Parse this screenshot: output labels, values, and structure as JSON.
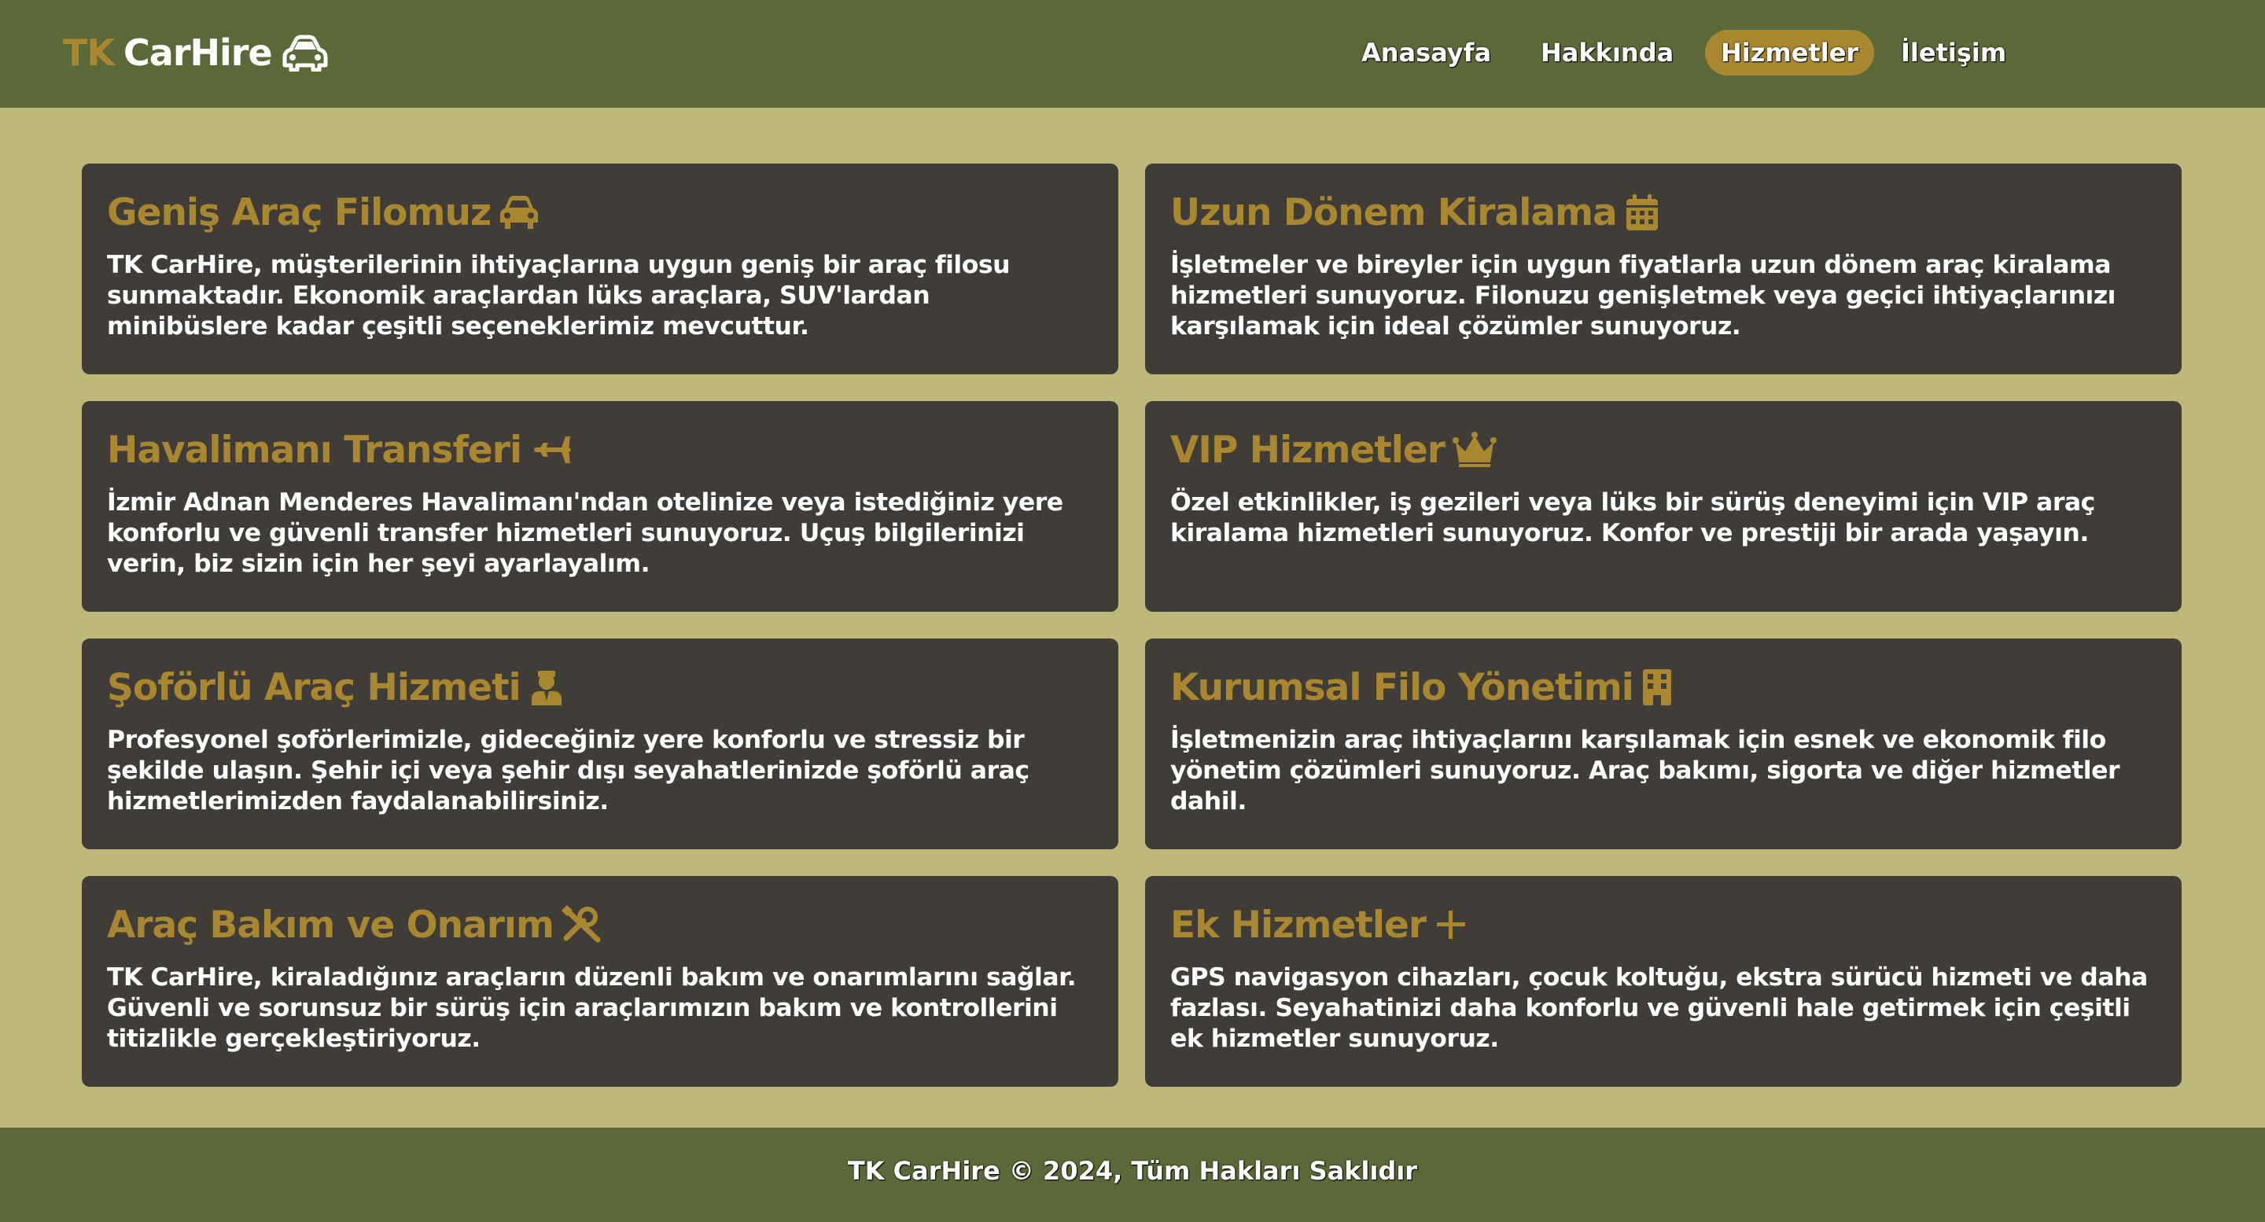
{
  "header": {
    "brand_prefix": "TK",
    "brand_name": "CarHire",
    "brand_icon": "car-icon"
  },
  "nav": {
    "items": [
      {
        "label": "Anasayfa",
        "active": false
      },
      {
        "label": "Hakkında",
        "active": false
      },
      {
        "label": "Hizmetler",
        "active": true
      },
      {
        "label": "İletişim",
        "active": false
      }
    ]
  },
  "services": [
    {
      "title": "Geniş Araç Filomuz",
      "icon": "car-icon",
      "text": "TK CarHire, müşterilerinin ihtiyaçlarına uygun geniş bir araç filosu sunmaktadır. Ekonomik araçlardan lüks araçlara, SUV'lardan minibüslere kadar çeşitli seçeneklerimiz mevcuttur."
    },
    {
      "title": "Uzun Dönem Kiralama",
      "icon": "calendar-icon",
      "text": "İşletmeler ve bireyler için uygun fiyatlarla uzun dönem araç kiralama hizmetleri sunuyoruz. Filonuzu genişletmek veya geçici ihtiyaçlarınızı karşılamak için ideal çözümler sunuyoruz."
    },
    {
      "title": "Havalimanı Transferi",
      "icon": "plane-icon",
      "text": "İzmir Adnan Menderes Havalimanı'ndan otelinize veya istediğiniz yere konforlu ve güvenli transfer hizmetleri sunuyoruz. Uçuş bilgilerinizi verin, biz sizin için her şeyi ayarlayalım."
    },
    {
      "title": "VIP Hizmetler",
      "icon": "crown-icon",
      "text": "Özel etkinlikler, iş gezileri veya lüks bir sürüş deneyimi için VIP araç kiralama hizmetleri sunuyoruz. Konfor ve prestiji bir arada yaşayın."
    },
    {
      "title": "Şoförlü Araç Hizmeti",
      "icon": "chauffeur-icon",
      "text": "Profesyonel şoförlerimizle, gideceğiniz yere konforlu ve stressiz bir şekilde ulaşın. Şehir içi veya şehir dışı seyahatlerinizde şoförlü araç hizmetlerimizden faydalanabilirsiniz."
    },
    {
      "title": "Kurumsal Filo Yönetimi",
      "icon": "building-icon",
      "text": "İşletmenizin araç ihtiyaçlarını karşılamak için esnek ve ekonomik filo yönetim çözümleri sunuyoruz. Araç bakımı, sigorta ve diğer hizmetler dahil."
    },
    {
      "title": "Araç Bakım ve Onarım",
      "icon": "tools-icon",
      "text": "TK CarHire, kiraladığınız araçların düzenli bakım ve onarımlarını sağlar. Güvenli ve sorunsuz bir sürüş için araçlarımızın bakım ve kontrollerini titizlikle gerçekleştiriyoruz."
    },
    {
      "title": "Ek Hizmetler",
      "icon": "plus-icon",
      "text": "GPS navigasyon cihazları, çocuk koltuğu, ekstra sürücü hizmeti ve daha fazlası. Seyahatinizi daha konforlu ve güvenli hale getirmek için çeşitli ek hizmetler sunuyoruz."
    }
  ],
  "footer": {
    "text": "TK CarHire © 2024, Tüm Hakları Saklıdır"
  },
  "colors": {
    "header_bg": "#5b6837",
    "page_bg": "#bdb97b",
    "card_bg": "#403d39",
    "accent": "#a88730",
    "text": "#ffffff"
  }
}
